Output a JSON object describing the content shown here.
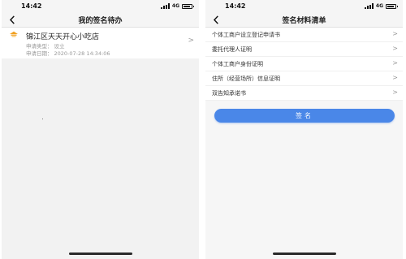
{
  "screens": {
    "left": {
      "status": {
        "time": "14:42",
        "network": "4G"
      },
      "nav": {
        "title": "我的签名待办"
      },
      "application": {
        "name": "锦江区天天开心小吃店",
        "type_label": "申请类型：",
        "type_value": "设立",
        "date_label": "申请日期：",
        "date_value": "2020-07-28 14:34:06"
      }
    },
    "right": {
      "status": {
        "time": "14:42",
        "network": "4G"
      },
      "nav": {
        "title": "签名材料清单"
      },
      "materials": [
        {
          "label": "个体工商户设立登记申请书"
        },
        {
          "label": "委托代理人证明"
        },
        {
          "label": "个体工商户身份证明"
        },
        {
          "label": "住所（经营场所）信息证明"
        },
        {
          "label": "双告知承诺书"
        }
      ],
      "sign_button": {
        "label": "签名"
      }
    }
  },
  "icons": {
    "back": "chevron-left-icon",
    "item_arrow": "chevron-right-icon",
    "shop": "shop-roof-icon"
  },
  "colors": {
    "accent": "#4a87e8",
    "shop_icon": "#f0a020"
  }
}
